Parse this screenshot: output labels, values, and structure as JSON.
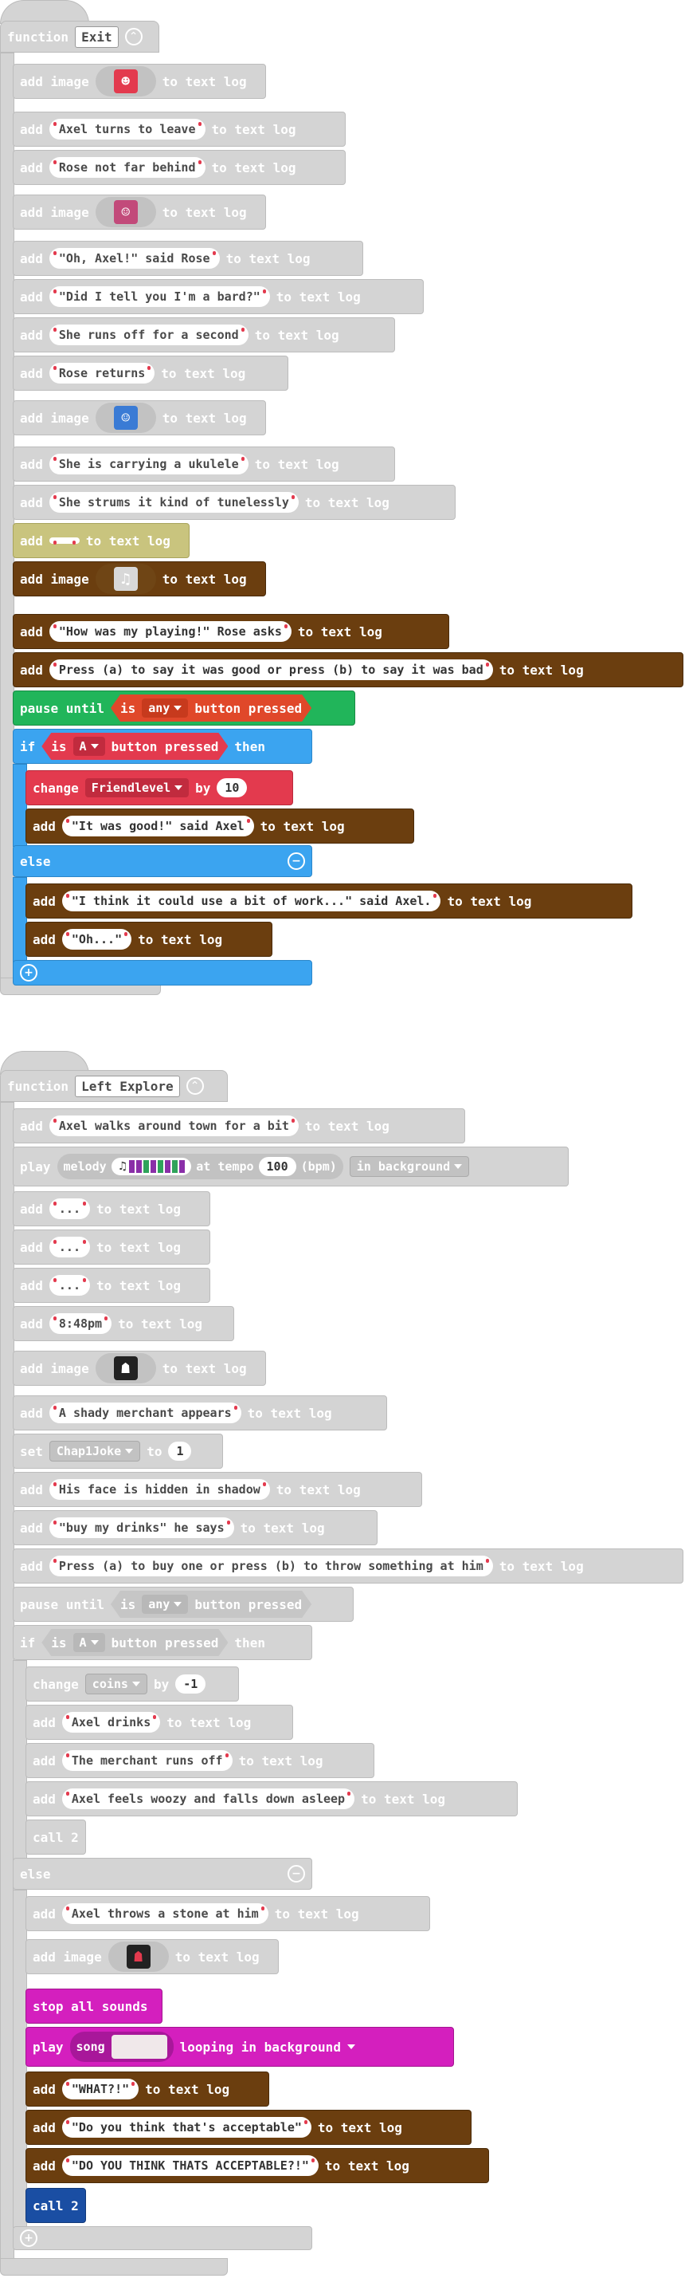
{
  "colors": {
    "gray": "#d4d4d4",
    "brown": "#6b3e0f",
    "green": "#21b55a",
    "blue": "#3ba4f0",
    "red": "#e33a4e",
    "magenta": "#d41fbe",
    "navy": "#1a4ea3",
    "khaki": "#c9c47e"
  },
  "kw": {
    "function": "function",
    "add": "add",
    "add_image": "add image",
    "to_text_log": "to text log",
    "pause_until": "pause until",
    "is": "is",
    "button_pressed": "button pressed",
    "if": "if",
    "then": "then",
    "else": "else",
    "change": "change",
    "by": "by",
    "play": "play",
    "melody": "melody",
    "at_tempo": "at tempo",
    "bpm": "(bpm)",
    "set": "set",
    "to": "to",
    "stop_all_sounds": "stop all sounds",
    "song": "song",
    "looping_in_background": "looping in background",
    "in_background": "in background",
    "call": "call"
  },
  "exit": {
    "name": "Exit",
    "lines": [
      "Axel turns to leave",
      "Rose not far behind",
      "\"Oh, Axel!\" said Rose",
      "\"Did I tell you I'm a bard?\"",
      "She runs off for a second",
      "Rose returns",
      "She is carrying a ukulele",
      "She strums it kind of tunelessly",
      "",
      "\"How was my playing!\" Rose asks",
      "Press (a) to say it was good or press (b) to say it was bad",
      "\"It was good!\" said Axel",
      "\"I think it could use a bit of work...\" said Axel.",
      "\"Oh...\""
    ],
    "any": "any",
    "button_a": "A",
    "variable": "Friendlevel",
    "change_by": "10"
  },
  "left": {
    "name": "Left Explore",
    "lines": [
      "Axel walks around town for a bit",
      "...",
      "...",
      "...",
      "8:48pm",
      "A shady merchant appears",
      "His face is hidden in shadow",
      "\"buy my drinks\" he says",
      "Press (a) to buy one or press (b) to throw something at him",
      "Axel drinks",
      "The merchant runs off",
      "Axel feels woozy and falls down asleep",
      "Axel throws a stone at him",
      "\"WHAT?!\"",
      "\"Do you think that's acceptable\"",
      "\"DO YOU THINK THATS ACCEPTABLE?!\""
    ],
    "tempo": "100",
    "set_var": "Chap1Joke",
    "set_val": "1",
    "any": "any",
    "button_a": "A",
    "coins_var": "coins",
    "coins_by": "-1",
    "call_1": "call 2",
    "call_2": "call 2"
  },
  "icons": [
    "collapse-icon",
    "add-branch-icon",
    "remove-branch-icon",
    "music-note-icon",
    "melody-icon",
    "song-icon",
    "sprite-axel-icon",
    "sprite-rose-icon",
    "sprite-merchant-icon"
  ]
}
